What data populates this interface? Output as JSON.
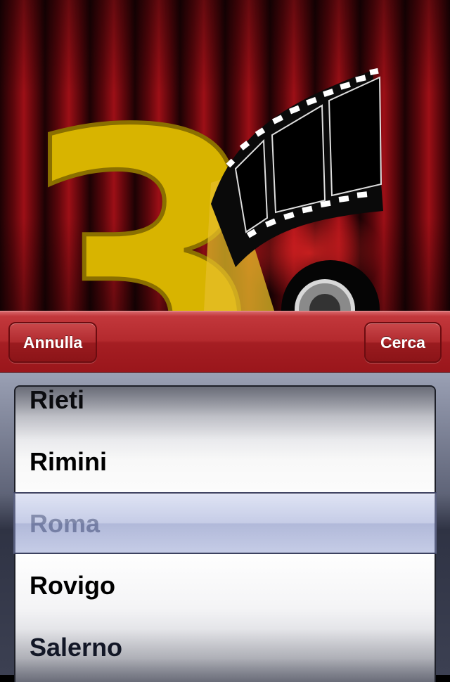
{
  "hero": {
    "badge_number": "3",
    "icons": [
      "film-strip-icon",
      "film-reel-icon"
    ]
  },
  "toolbar": {
    "cancel_label": "Annulla",
    "search_label": "Cerca"
  },
  "picker": {
    "items": [
      "Rieti",
      "Rimini",
      "Roma",
      "Rovigo",
      "Salerno"
    ],
    "selected": "Roma"
  },
  "colors": {
    "toolbar_red": "#b42a2e",
    "curtain_red": "#9c0f16",
    "badge_yellow": "#d8b400",
    "selection_blue": "#96a2d2"
  }
}
